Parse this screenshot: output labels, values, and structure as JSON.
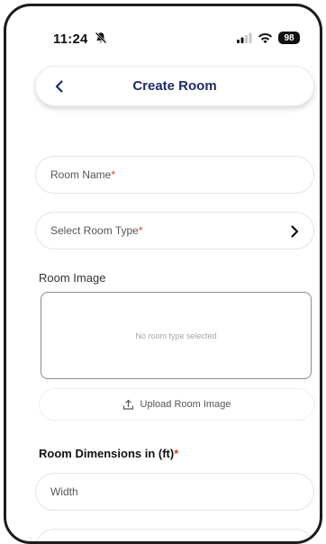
{
  "status_bar": {
    "time": "11:24",
    "battery": "98",
    "icons": [
      "bell-slash-icon",
      "signal-icon",
      "wifi-icon",
      "battery-icon"
    ]
  },
  "header": {
    "title": "Create Room",
    "back_icon": "chevron-left-icon",
    "title_color": "#1d2b6b"
  },
  "form": {
    "room_name": {
      "placeholder": "Room Name",
      "required_mark": "*"
    },
    "room_type": {
      "placeholder": "Select Room Type",
      "required_mark": "*",
      "icon": "chevron-right-icon"
    },
    "room_image": {
      "label": "Room Image",
      "empty_text": "No room type selected",
      "upload_label": "Upload Room Image",
      "upload_icon": "upload-icon"
    },
    "dimensions": {
      "label": "Room Dimensions in (ft)",
      "required_mark": "*",
      "width_placeholder": "Width"
    }
  },
  "colors": {
    "required": "#e53935",
    "frame": "#1c1c1c"
  }
}
